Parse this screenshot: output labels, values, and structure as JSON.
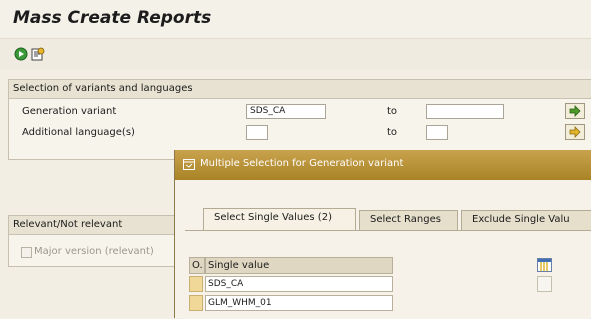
{
  "window": {
    "title": "Mass Create Reports"
  },
  "toolbar": {
    "icons": [
      "execute-icon",
      "variant-icon"
    ]
  },
  "selection_section": {
    "title": "Selection of variants and languages",
    "rows": [
      {
        "label": "Generation variant",
        "value": "SDS_CA",
        "to_label": "to",
        "to_value": ""
      },
      {
        "label": "Additional language(s)",
        "value": "",
        "to_label": "to",
        "to_value": ""
      }
    ]
  },
  "relevance_section": {
    "title": "Relevant/Not relevant",
    "checkbox_label": "Major version (relevant)",
    "checked": false
  },
  "dialog": {
    "title": "Multiple Selection for Generation variant",
    "tabs": [
      {
        "label": "Select Single Values (2)",
        "active": true
      },
      {
        "label": "Select Ranges",
        "active": false
      },
      {
        "label": "Exclude Single Valu",
        "active": false
      }
    ],
    "grid": {
      "col_option": "O.",
      "col_value": "Single value",
      "rows": [
        "SDS_CA",
        "GLM_WHM_01"
      ]
    }
  },
  "colors": {
    "dialog_title_bg": "#b8922f",
    "selection_cell": "#f0d998",
    "background": "#f2eee4"
  }
}
